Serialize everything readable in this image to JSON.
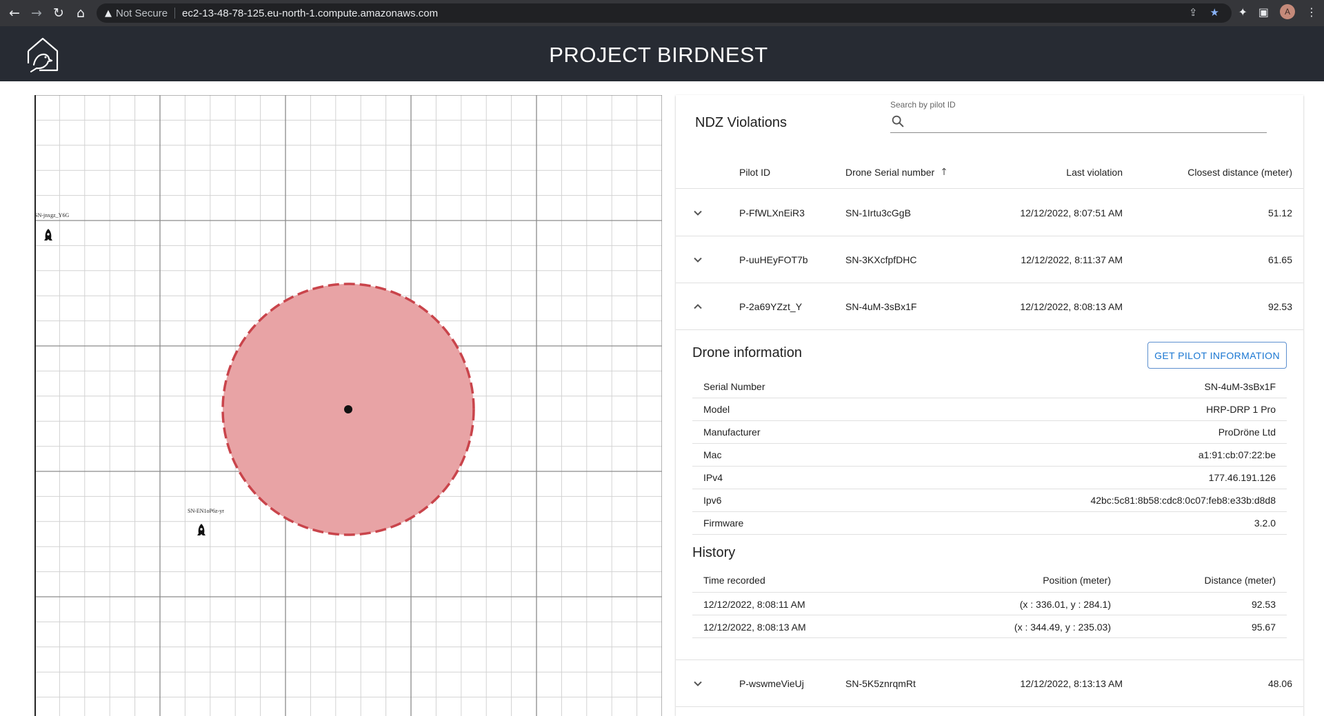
{
  "browser": {
    "security_label": "Not Secure",
    "url": "ec2-13-48-78-125.eu-north-1.compute.amazonaws.com",
    "profile_initial": "A"
  },
  "header": {
    "title": "PROJECT BIRDNEST"
  },
  "map": {
    "drones": [
      {
        "label": "SN-jnxgz_Y6G"
      },
      {
        "label": "SN-EN1oP6z-yr"
      }
    ],
    "colors": {
      "ndz_fill": "#e8a3a5",
      "ndz_stroke": "#c9444b",
      "grid": "#cfcfcf",
      "grid_major": "#8a8a8a"
    }
  },
  "violations": {
    "title": "NDZ Violations",
    "search": {
      "label": "Search by pilot ID",
      "value": "",
      "placeholder": ""
    },
    "columns": {
      "pilot_id": "Pilot ID",
      "serial": "Drone Serial number",
      "last_violation": "Last violation",
      "closest": "Closest distance (meter)"
    },
    "rows": [
      {
        "pilot_id": "P-FfWLXnEiR3",
        "serial": "SN-1Irtu3cGgB",
        "last_violation": "12/12/2022, 8:07:51 AM",
        "closest": "51.12",
        "expanded": false
      },
      {
        "pilot_id": "P-uuHEyFOT7b",
        "serial": "SN-3KXcfpfDHC",
        "last_violation": "12/12/2022, 8:11:37 AM",
        "closest": "61.65",
        "expanded": false
      },
      {
        "pilot_id": "P-2a69YZzt_Y",
        "serial": "SN-4uM-3sBx1F",
        "last_violation": "12/12/2022, 8:08:13 AM",
        "closest": "92.53",
        "expanded": true
      },
      {
        "pilot_id": "P-wswmeVieUj",
        "serial": "SN-5K5znrqmRt",
        "last_violation": "12/12/2022, 8:13:13 AM",
        "closest": "48.06",
        "expanded": false
      }
    ],
    "detail": {
      "title": "Drone information",
      "pilot_button": "GET PILOT INFORMATION",
      "info": [
        {
          "key": "Serial Number",
          "value": "SN-4uM-3sBx1F"
        },
        {
          "key": "Model",
          "value": "HRP-DRP 1 Pro"
        },
        {
          "key": "Manufacturer",
          "value": "ProDröne Ltd"
        },
        {
          "key": "Mac",
          "value": "a1:91:cb:07:22:be"
        },
        {
          "key": "IPv4",
          "value": "177.46.191.126"
        },
        {
          "key": "Ipv6",
          "value": "42bc:5c81:8b58:cdc8:0c07:feb8:e33b:d8d8"
        },
        {
          "key": "Firmware",
          "value": "3.2.0"
        }
      ],
      "history_title": "History",
      "history_columns": {
        "time": "Time recorded",
        "position": "Position (meter)",
        "distance": "Distance (meter)"
      },
      "history": [
        {
          "time": "12/12/2022, 8:08:11 AM",
          "position": "(x : 336.01, y : 284.1)",
          "distance": "92.53"
        },
        {
          "time": "12/12/2022, 8:08:13 AM",
          "position": "(x : 344.49, y : 235.03)",
          "distance": "95.67"
        }
      ]
    }
  }
}
